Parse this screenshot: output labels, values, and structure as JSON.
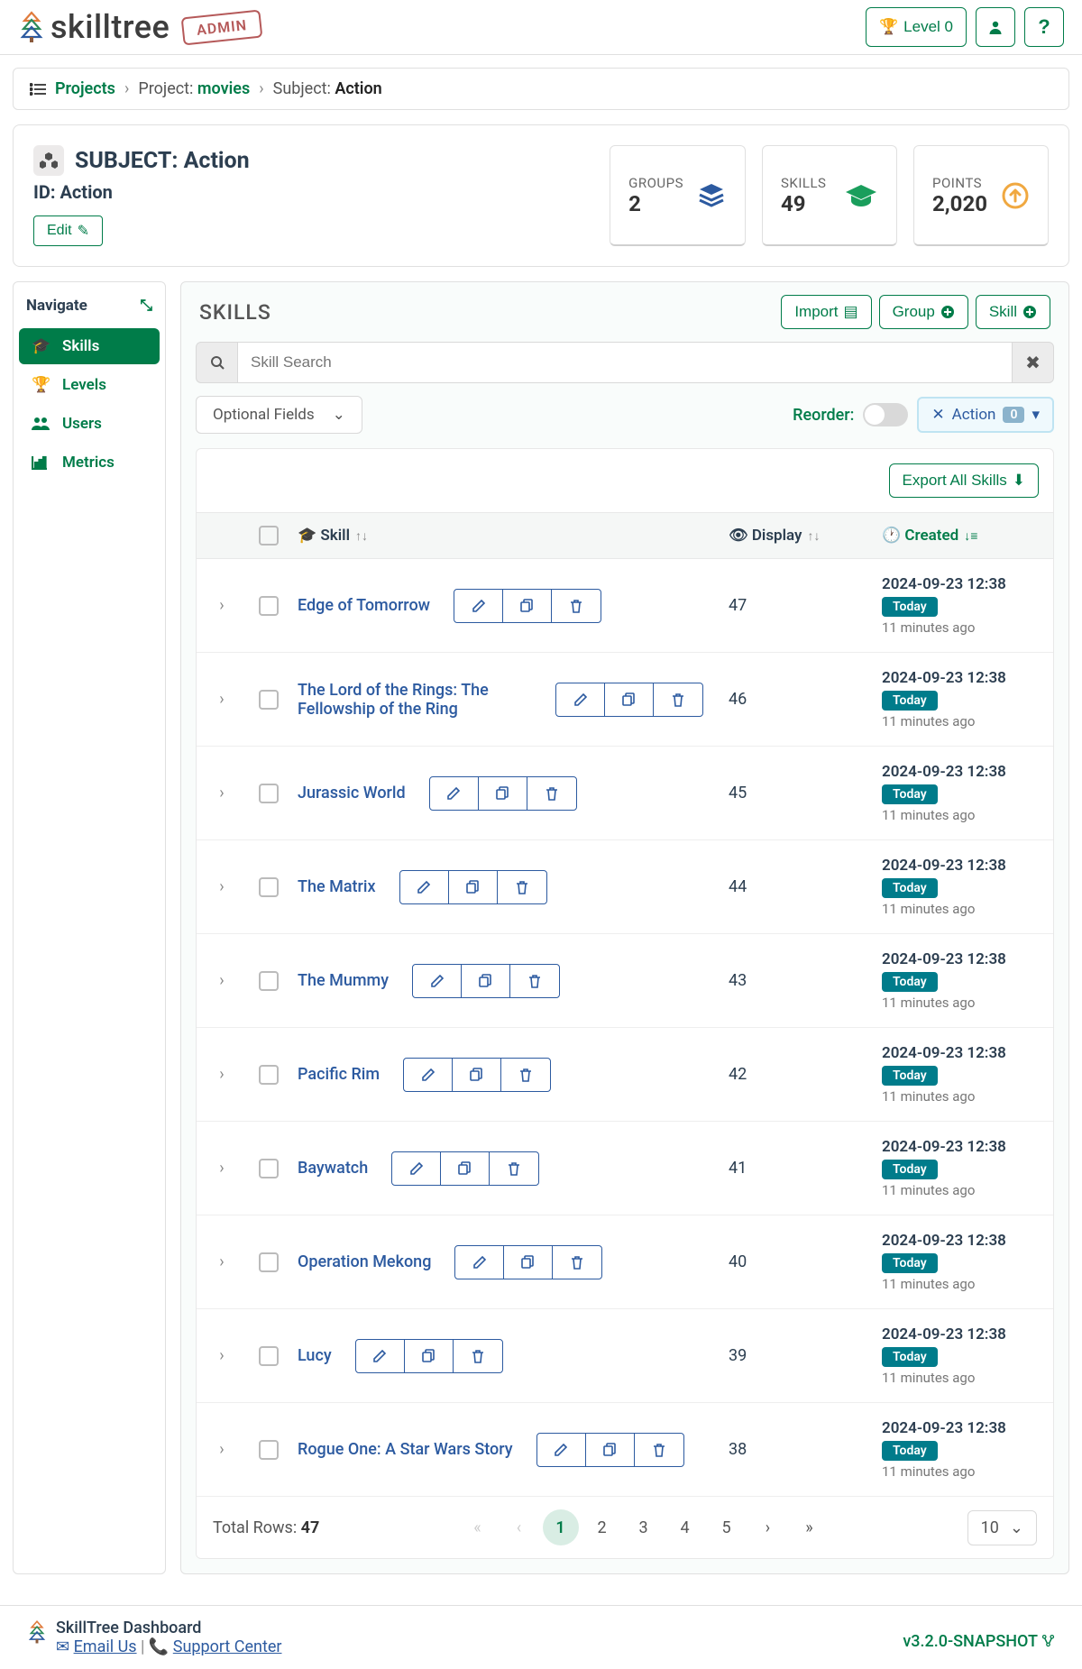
{
  "header": {
    "logoText": "skilltree",
    "adminStamp": "ADMIN",
    "levelLabel": "Level 0"
  },
  "breadcrumb": {
    "root": "Projects",
    "projectLabel": "Project:",
    "projectVal": "movies",
    "subjectLabel": "Subject:",
    "subjectVal": "Action"
  },
  "subject": {
    "titlePrefix": "SUBJECT:",
    "titleName": "Action",
    "idLabel": "ID: Action",
    "editLabel": "Edit"
  },
  "stats": {
    "groups": {
      "label": "GROUPS",
      "value": "2"
    },
    "skills": {
      "label": "SKILLS",
      "value": "49"
    },
    "points": {
      "label": "POINTS",
      "value": "2,020"
    }
  },
  "nav": {
    "title": "Navigate",
    "items": [
      "Skills",
      "Levels",
      "Users",
      "Metrics"
    ]
  },
  "panel": {
    "title": "SKILLS",
    "import": "Import",
    "group": "Group",
    "skill": "Skill",
    "searchPlaceholder": "Skill Search",
    "optionalFields": "Optional Fields",
    "reorderLabel": "Reorder:",
    "actionLabel": "Action",
    "actionCount": "0",
    "exportLabel": "Export All Skills"
  },
  "columns": {
    "skill": "Skill",
    "display": "Display",
    "created": "Created"
  },
  "rows": [
    {
      "name": "Edge of Tomorrow",
      "display": "47",
      "created": "2024-09-23 12:38",
      "badge": "Today",
      "ago": "11 minutes ago"
    },
    {
      "name": "The Lord of the Rings: The Fellowship of the Ring",
      "display": "46",
      "created": "2024-09-23 12:38",
      "badge": "Today",
      "ago": "11 minutes ago"
    },
    {
      "name": "Jurassic World",
      "display": "45",
      "created": "2024-09-23 12:38",
      "badge": "Today",
      "ago": "11 minutes ago"
    },
    {
      "name": "The Matrix",
      "display": "44",
      "created": "2024-09-23 12:38",
      "badge": "Today",
      "ago": "11 minutes ago"
    },
    {
      "name": "The Mummy",
      "display": "43",
      "created": "2024-09-23 12:38",
      "badge": "Today",
      "ago": "11 minutes ago"
    },
    {
      "name": "Pacific Rim",
      "display": "42",
      "created": "2024-09-23 12:38",
      "badge": "Today",
      "ago": "11 minutes ago"
    },
    {
      "name": "Baywatch",
      "display": "41",
      "created": "2024-09-23 12:38",
      "badge": "Today",
      "ago": "11 minutes ago"
    },
    {
      "name": "Operation Mekong",
      "display": "40",
      "created": "2024-09-23 12:38",
      "badge": "Today",
      "ago": "11 minutes ago"
    },
    {
      "name": "Lucy",
      "display": "39",
      "created": "2024-09-23 12:38",
      "badge": "Today",
      "ago": "11 minutes ago"
    },
    {
      "name": "Rogue One: A Star Wars Story",
      "display": "38",
      "created": "2024-09-23 12:38",
      "badge": "Today",
      "ago": "11 minutes ago"
    }
  ],
  "pager": {
    "totalLabel": "Total Rows:",
    "totalVal": "47",
    "pages": [
      "1",
      "2",
      "3",
      "4",
      "5"
    ],
    "pageSize": "10"
  },
  "footer": {
    "title": "SkillTree Dashboard",
    "email": "Email Us",
    "support": "Support Center",
    "version": "v3.2.0-SNAPSHOT"
  }
}
